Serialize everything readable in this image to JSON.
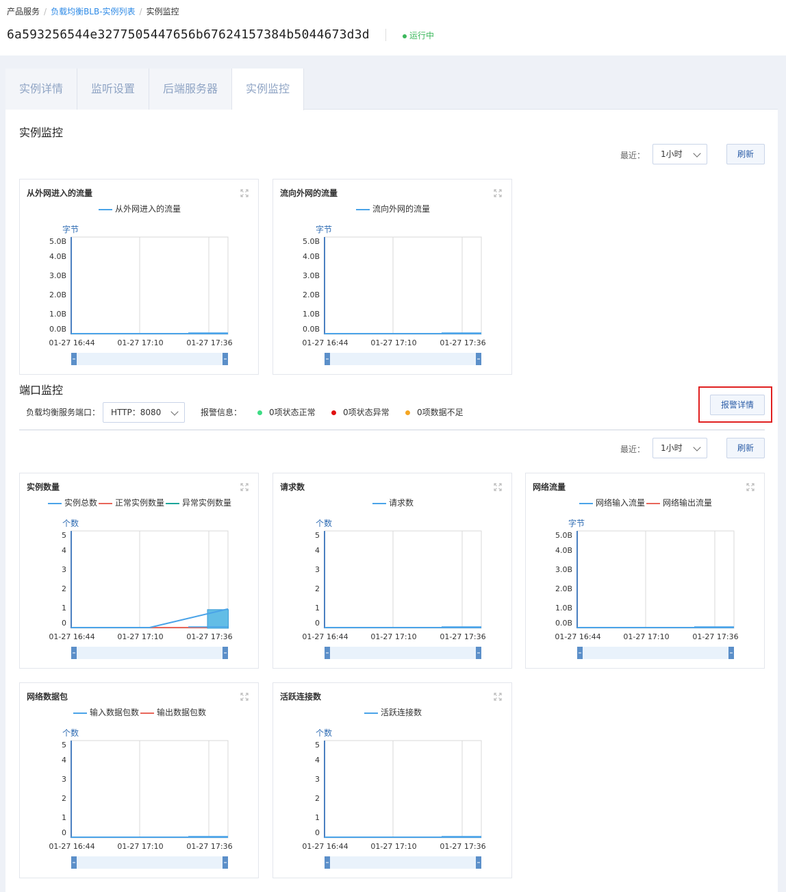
{
  "breadcrumb": {
    "root": "产品服务",
    "list": "负载均衡BLB-实例列表",
    "current": "实例监控"
  },
  "header": {
    "instance_id": "6a593256544e3277505447656b67624157384b5044673d3d",
    "status": "运行中"
  },
  "tabs": [
    "实例详情",
    "监听设置",
    "后端服务器",
    "实例监控"
  ],
  "instance_monitor": {
    "title": "实例监控",
    "recent_label": "最近：",
    "range": "1小时",
    "refresh": "刷新"
  },
  "port_monitor": {
    "title": "端口监控",
    "port_label": "负载均衡服务端口：",
    "port_value": "HTTP：8080",
    "alarm_label": "报警信息：",
    "alarm_ok": "0项状态正常",
    "alarm_err": "0项状态异常",
    "alarm_insuf": "0项数据不足",
    "alarm_detail": "报警详情",
    "recent_label": "最近：",
    "range": "1小时",
    "refresh": "刷新"
  },
  "colors": {
    "blue": "#4aa3e8",
    "red": "#e8665a",
    "teal": "#1aa59a",
    "ok": "#3ddc84",
    "err": "#e01010",
    "insuf": "#f5a623"
  },
  "chart_data": [
    {
      "type": "line",
      "title": "从外网进入的流量",
      "ylabel": "字节",
      "yticks": [
        "5.0B",
        "4.0B",
        "3.0B",
        "2.0B",
        "1.0B",
        "0.0B"
      ],
      "x": [
        "01-27 16:44",
        "01-27 17:10",
        "01-27 17:36"
      ],
      "series": [
        {
          "name": "从外网进入的流量",
          "values": [
            0,
            0,
            0
          ]
        }
      ]
    },
    {
      "type": "line",
      "title": "流向外网的流量",
      "ylabel": "字节",
      "yticks": [
        "5.0B",
        "4.0B",
        "3.0B",
        "2.0B",
        "1.0B",
        "0.0B"
      ],
      "x": [
        "01-27 16:44",
        "01-27 17:10",
        "01-27 17:36"
      ],
      "series": [
        {
          "name": "流向外网的流量",
          "values": [
            0,
            0,
            0
          ]
        }
      ]
    },
    {
      "type": "area",
      "title": "实例数量",
      "ylabel": "个数",
      "yticks": [
        "5",
        "4",
        "3",
        "2",
        "1",
        "0"
      ],
      "x": [
        "01-27 16:44",
        "01-27 17:10",
        "01-27 17:36"
      ],
      "series": [
        {
          "name": "实例总数",
          "values": [
            0,
            0,
            1
          ]
        },
        {
          "name": "正常实例数量",
          "values": [
            0,
            0,
            0
          ]
        },
        {
          "name": "异常实例数量",
          "values": [
            0,
            0,
            0
          ]
        }
      ]
    },
    {
      "type": "line",
      "title": "请求数",
      "ylabel": "个数",
      "yticks": [
        "5",
        "4",
        "3",
        "2",
        "1",
        "0"
      ],
      "x": [
        "01-27 16:44",
        "01-27 17:10",
        "01-27 17:36"
      ],
      "series": [
        {
          "name": "请求数",
          "values": [
            0,
            0,
            0
          ]
        }
      ]
    },
    {
      "type": "line",
      "title": "网络流量",
      "ylabel": "字节",
      "yticks": [
        "5.0B",
        "4.0B",
        "3.0B",
        "2.0B",
        "1.0B",
        "0.0B"
      ],
      "x": [
        "01-27 16:44",
        "01-27 17:10",
        "01-27 17:36"
      ],
      "series": [
        {
          "name": "网络输入流量",
          "values": [
            0,
            0,
            0
          ]
        },
        {
          "name": "网络输出流量",
          "values": [
            0,
            0,
            0
          ]
        }
      ]
    },
    {
      "type": "line",
      "title": "网络数据包",
      "ylabel": "个数",
      "yticks": [
        "5",
        "4",
        "3",
        "2",
        "1",
        "0"
      ],
      "x": [
        "01-27 16:44",
        "01-27 17:10",
        "01-27 17:36"
      ],
      "series": [
        {
          "name": "输入数据包数",
          "values": [
            0,
            0,
            0
          ]
        },
        {
          "name": "输出数据包数",
          "values": [
            0,
            0,
            0
          ]
        }
      ]
    },
    {
      "type": "line",
      "title": "活跃连接数",
      "ylabel": "个数",
      "yticks": [
        "5",
        "4",
        "3",
        "2",
        "1",
        "0"
      ],
      "x": [
        "01-27 16:44",
        "01-27 17:10",
        "01-27 17:36"
      ],
      "series": [
        {
          "name": "活跃连接数",
          "values": [
            0,
            0,
            0
          ]
        }
      ]
    }
  ]
}
